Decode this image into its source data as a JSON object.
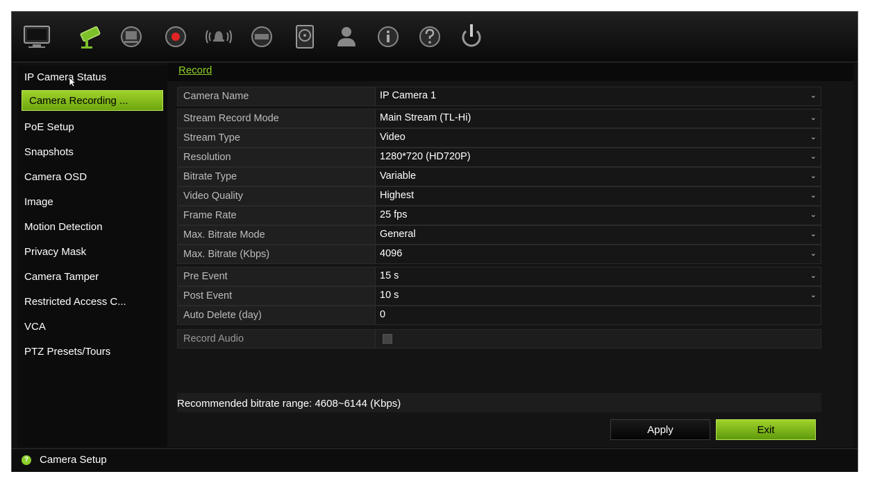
{
  "toolbar": {
    "icons": [
      "monitor-icon",
      "camera-icon",
      "network-icon",
      "record-icon",
      "alarm-icon",
      "device-icon",
      "hdd-icon",
      "user-icon",
      "info-icon",
      "help-icon",
      "power-icon"
    ]
  },
  "sidebar": {
    "items": [
      {
        "label": "IP Camera Status"
      },
      {
        "label": "Camera Recording ..."
      },
      {
        "label": "PoE Setup"
      },
      {
        "label": "Snapshots"
      },
      {
        "label": "Camera OSD"
      },
      {
        "label": "Image"
      },
      {
        "label": "Motion Detection"
      },
      {
        "label": "Privacy Mask"
      },
      {
        "label": "Camera Tamper"
      },
      {
        "label": "Restricted Access C..."
      },
      {
        "label": "VCA"
      },
      {
        "label": "PTZ Presets/Tours"
      }
    ],
    "active_index": 1
  },
  "content": {
    "tab_label": "Record",
    "rows": [
      {
        "label": "Camera Name",
        "value": "IP Camera 1"
      },
      {
        "label": "Stream Record Mode",
        "value": "Main Stream (TL-Hi)"
      },
      {
        "label": "Stream Type",
        "value": "Video"
      },
      {
        "label": "Resolution",
        "value": "1280*720 (HD720P)"
      },
      {
        "label": "Bitrate Type",
        "value": "Variable"
      },
      {
        "label": "Video Quality",
        "value": "Highest"
      },
      {
        "label": "Frame Rate",
        "value": "25 fps"
      },
      {
        "label": "Max. Bitrate Mode",
        "value": "General"
      },
      {
        "label": "Max. Bitrate (Kbps)",
        "value": "4096"
      },
      {
        "label": "Pre Event",
        "value": "15 s"
      },
      {
        "label": "Post Event",
        "value": "10 s"
      },
      {
        "label": "Auto Delete (day)",
        "value": "0"
      },
      {
        "label": "Record Audio",
        "value": ""
      }
    ],
    "recommendation": "Recommended bitrate range: 4608~6144 (Kbps)",
    "apply_label": "Apply",
    "exit_label": "Exit"
  },
  "statusbar": {
    "text": "Camera Setup"
  },
  "colors": {
    "accent_green": "#8fd12a",
    "background": "#101010"
  }
}
